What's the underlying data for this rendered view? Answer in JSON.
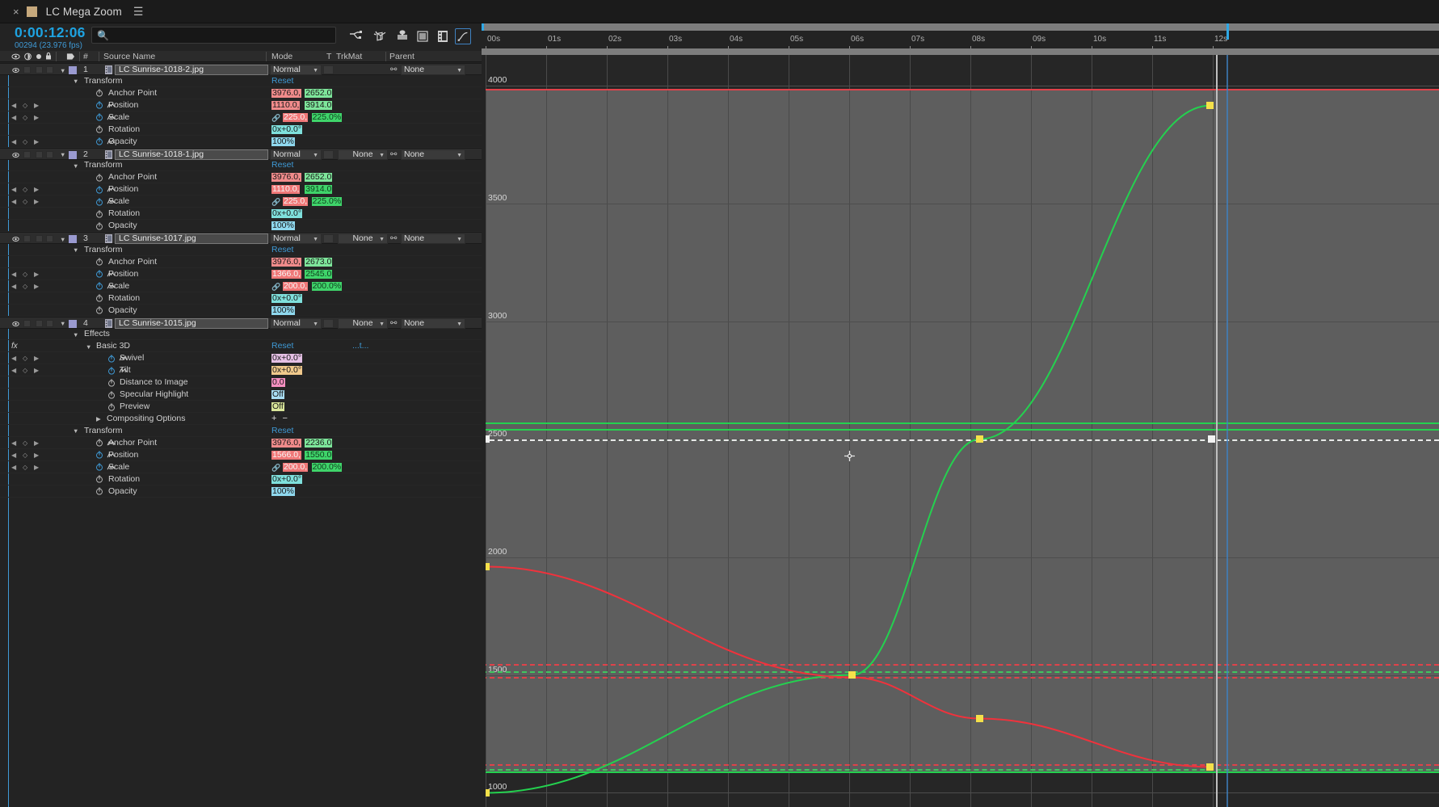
{
  "panel": {
    "close_label": "×",
    "comp_name": "LC Mega Zoom",
    "menu_glyph": "☰"
  },
  "timecode": {
    "current": "0:00:12:06",
    "frames_fps": "00294 (23.976 fps)"
  },
  "search": {
    "placeholder": "",
    "value": ""
  },
  "toolbar_icons": [
    {
      "name": "graph-editor-toggle-icon",
      "label": "graph-editor"
    },
    {
      "name": "motion-blur-icon",
      "label": "motion-blur"
    },
    {
      "name": "brainstorm-icon",
      "label": "brainstorm"
    },
    {
      "name": "graph-editor-icon",
      "label": "graph-editor-active"
    }
  ],
  "columns": {
    "source_name": "Source Name",
    "mode": "Mode",
    "t": "T",
    "trkmat": "TrkMat",
    "parent": "Parent",
    "hash": "#"
  },
  "rows": [
    {
      "kind": "layer",
      "index": "1",
      "name": "LC Sunrise-1018-2.jpg",
      "mode": "Normal",
      "trkmat": "",
      "parent": "None"
    },
    {
      "kind": "group",
      "indent": 1,
      "label": "Transform",
      "value": "Reset"
    },
    {
      "kind": "prop",
      "indent": 2,
      "label": "Anchor Point",
      "vx": "3976.0,",
      "vy": "2652.0",
      "style": "xy",
      "kf": false,
      "stopwatch": false,
      "graph": false
    },
    {
      "kind": "prop",
      "indent": 2,
      "label": "Position",
      "vx": "1110.0,",
      "vy": "3914.0",
      "style": "xy",
      "kf": true,
      "stopwatch": true,
      "graph": true
    },
    {
      "kind": "prop",
      "indent": 2,
      "label": "Scale",
      "vx": "225.0,",
      "vy": "225.0%",
      "style": "xys",
      "kf": true,
      "stopwatch": true,
      "graph": true,
      "link": true
    },
    {
      "kind": "prop",
      "indent": 2,
      "label": "Rotation",
      "v": "0x+0.0°",
      "style": "rot",
      "kf": false,
      "stopwatch": false,
      "graph": false
    },
    {
      "kind": "prop",
      "indent": 2,
      "label": "Opacity",
      "v": "100%",
      "style": "op",
      "kf": true,
      "stopwatch": true,
      "graph": true
    },
    {
      "kind": "layer",
      "index": "2",
      "name": "LC Sunrise-1018-1.jpg",
      "mode": "Normal",
      "trkmat": "None",
      "parent": "None"
    },
    {
      "kind": "group",
      "indent": 1,
      "label": "Transform",
      "value": "Reset"
    },
    {
      "kind": "prop",
      "indent": 2,
      "label": "Anchor Point",
      "vx": "3976.0,",
      "vy": "2652.0",
      "style": "xy",
      "kf": false,
      "stopwatch": false,
      "graph": false
    },
    {
      "kind": "prop",
      "indent": 2,
      "label": "Position",
      "vx": "1110.0,",
      "vy": "3914.0",
      "style": "xys",
      "kf": true,
      "stopwatch": true,
      "graph": true
    },
    {
      "kind": "prop",
      "indent": 2,
      "label": "Scale",
      "vx": "225.0,",
      "vy": "225.0%",
      "style": "xys",
      "kf": true,
      "stopwatch": true,
      "graph": true,
      "link": true
    },
    {
      "kind": "prop",
      "indent": 2,
      "label": "Rotation",
      "v": "0x+0.0°",
      "style": "rot",
      "kf": false,
      "stopwatch": false,
      "graph": false
    },
    {
      "kind": "prop",
      "indent": 2,
      "label": "Opacity",
      "v": "100%",
      "style": "op",
      "kf": false,
      "stopwatch": false,
      "graph": false
    },
    {
      "kind": "layer",
      "index": "3",
      "name": "LC Sunrise-1017.jpg",
      "mode": "Normal",
      "trkmat": "None",
      "parent": "None"
    },
    {
      "kind": "group",
      "indent": 1,
      "label": "Transform",
      "value": "Reset"
    },
    {
      "kind": "prop",
      "indent": 2,
      "label": "Anchor Point",
      "vx": "3976.0,",
      "vy": "2673.0",
      "style": "xy",
      "kf": false,
      "stopwatch": false,
      "graph": false
    },
    {
      "kind": "prop",
      "indent": 2,
      "label": "Position",
      "vx": "1366.0,",
      "vy": "2545.0",
      "style": "xys",
      "kf": true,
      "stopwatch": true,
      "graph": true
    },
    {
      "kind": "prop",
      "indent": 2,
      "label": "Scale",
      "vx": "200.0,",
      "vy": "200.0%",
      "style": "xys",
      "kf": true,
      "stopwatch": true,
      "graph": true,
      "link": true
    },
    {
      "kind": "prop",
      "indent": 2,
      "label": "Rotation",
      "v": "0x+0.0°",
      "style": "rot",
      "kf": false,
      "stopwatch": false,
      "graph": false
    },
    {
      "kind": "prop",
      "indent": 2,
      "label": "Opacity",
      "v": "100%",
      "style": "op",
      "kf": false,
      "stopwatch": false,
      "graph": false
    },
    {
      "kind": "layer",
      "index": "4",
      "name": "LC Sunrise-1015.jpg",
      "mode": "Normal",
      "trkmat": "None",
      "parent": "None"
    },
    {
      "kind": "group",
      "indent": 1,
      "label": "Effects",
      "value": ""
    },
    {
      "kind": "effect",
      "indent": 2,
      "label": "Basic 3D",
      "value": "Reset",
      "extra": "...t..."
    },
    {
      "kind": "prop",
      "indent": 3,
      "label": "Swivel",
      "v": "0x+0.0°",
      "style": "swivel",
      "kf": true,
      "stopwatch": true,
      "graph": true
    },
    {
      "kind": "prop",
      "indent": 3,
      "label": "Tilt",
      "v": "0x+0.0°",
      "style": "tilt",
      "kf": true,
      "stopwatch": true,
      "graph": true
    },
    {
      "kind": "prop",
      "indent": 3,
      "label": "Distance to Image",
      "v": "0.0",
      "style": "dist",
      "kf": false,
      "stopwatch": false,
      "graph": false
    },
    {
      "kind": "prop",
      "indent": 3,
      "label": "Specular Highlight",
      "v": "Off",
      "style": "spec",
      "kf": false,
      "stopwatch": false,
      "graph": false
    },
    {
      "kind": "prop",
      "indent": 3,
      "label": "Preview",
      "v": "Off",
      "style": "prev",
      "kf": false,
      "stopwatch": false,
      "graph": false
    },
    {
      "kind": "collapsed",
      "indent": 2,
      "label": "Compositing Options",
      "value": "+ −"
    },
    {
      "kind": "group",
      "indent": 1,
      "label": "Transform",
      "value": "Reset"
    },
    {
      "kind": "prop",
      "indent": 2,
      "label": "Anchor Point",
      "vx": "3976.0,",
      "vy": "2236.0",
      "style": "plain",
      "kf": true,
      "stopwatch": false,
      "graph": true
    },
    {
      "kind": "prop",
      "indent": 2,
      "label": "Position",
      "vx": "1566.0,",
      "vy": "1550.0",
      "style": "xys",
      "kf": true,
      "stopwatch": true,
      "graph": true
    },
    {
      "kind": "prop",
      "indent": 2,
      "label": "Scale",
      "vx": "200.0,",
      "vy": "200.0%",
      "style": "xys",
      "kf": true,
      "stopwatch": true,
      "graph": true,
      "link": true
    },
    {
      "kind": "prop",
      "indent": 2,
      "label": "Rotation",
      "v": "0x+0.0°",
      "style": "rot",
      "kf": false,
      "stopwatch": false,
      "graph": false
    },
    {
      "kind": "prop",
      "indent": 2,
      "label": "Opacity",
      "v": "100%",
      "style": "op",
      "kf": false,
      "stopwatch": false,
      "graph": false
    }
  ],
  "graph_editor": {
    "time_ticks": [
      "00s",
      "01s",
      "02s",
      "03s",
      "04s",
      "05s",
      "06s",
      "07s",
      "08s",
      "09s",
      "10s",
      "11s",
      "12s"
    ],
    "value_labels": [
      "4000",
      "3500",
      "3000",
      "2500",
      "2000",
      "1500",
      "1000"
    ],
    "value_min": 1000,
    "value_max": 4000,
    "colors": {
      "x_curve": "#f0323c",
      "y_curve": "#24d14f",
      "keyframe": "#f4e04a",
      "keyframe_selected": "#f2f2f2",
      "grid": "#4a4a4a",
      "graph_bg": "#5e5e5e",
      "playhead": "#bfbfbf",
      "time_indicator": "#2ea8e6"
    },
    "curves": [
      {
        "name": "position-y-green",
        "color": "#24d14f",
        "points": [
          {
            "t": 0.0,
            "v": 1000
          },
          {
            "t": 6.05,
            "v": 1500
          },
          {
            "t": 8.15,
            "v": 2500
          },
          {
            "t": 11.95,
            "v": 3915
          }
        ]
      },
      {
        "name": "position-x-red",
        "color": "#f0323c",
        "points": [
          {
            "t": 0.0,
            "v": 1960
          },
          {
            "t": 6.05,
            "v": 1490
          },
          {
            "t": 8.15,
            "v": 1315
          },
          {
            "t": 11.95,
            "v": 1110
          }
        ]
      }
    ],
    "keyframes": [
      {
        "t": 0.0,
        "v": 1000,
        "color": "#f4e04a"
      },
      {
        "t": 0.0,
        "v": 1960,
        "color": "#f4e04a"
      },
      {
        "t": 6.05,
        "v": 1500,
        "color": "#f4e04a"
      },
      {
        "t": 8.15,
        "v": 2500,
        "color": "#f4e04a"
      },
      {
        "t": 8.15,
        "v": 1315,
        "color": "#f4e04a"
      },
      {
        "t": 11.95,
        "v": 3915,
        "color": "#f4e04a"
      },
      {
        "t": 11.95,
        "v": 1110,
        "color": "#f4e04a"
      },
      {
        "t": 0.0,
        "v": 2500,
        "color": "#f2f2f2"
      },
      {
        "t": 11.98,
        "v": 2500,
        "color": "#f2f2f2"
      }
    ],
    "playhead_time": "12.05",
    "cursor_position": "06s / 2450"
  }
}
